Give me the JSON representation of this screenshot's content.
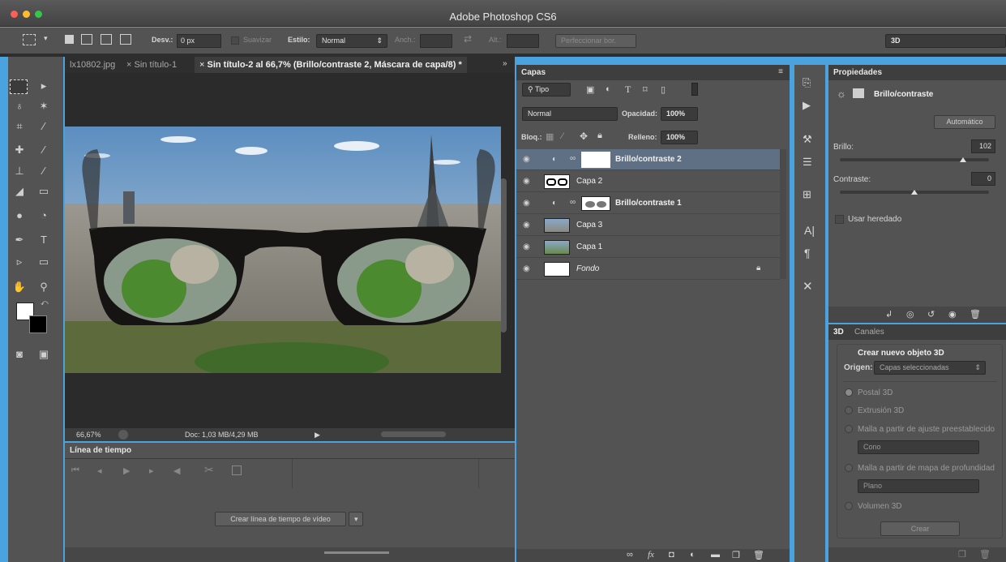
{
  "app": {
    "title": "Adobe Photoshop CS6"
  },
  "options": {
    "desv_label": "Desv.:",
    "desv_value": "0 px",
    "suavizar": "Suavizar",
    "estilo_label": "Estilo:",
    "estilo_value": "Normal",
    "anch_label": "Anch.:",
    "alt_label": "Alt.:",
    "refine_button": "Perfeccionar bor.",
    "workspace": "3D"
  },
  "tabs": [
    {
      "label": "lx10802.jpg"
    },
    {
      "label": "Sin título-1"
    },
    {
      "label": "Sin título-2 al 66,7% (Brillo/contraste 2, Máscara de capa/8) *"
    }
  ],
  "status": {
    "zoom": "66,67%",
    "doc": "Doc: 1,03 MB/4,29 MB"
  },
  "timeline": {
    "title": "Línea de tiempo",
    "create_button": "Crear línea de tiempo de vídeo"
  },
  "layers": {
    "title": "Capas",
    "filter": "Tipo",
    "blend": "Normal",
    "opacity_label": "Opacidad:",
    "opacity_value": "100%",
    "lock_label": "Bloq.:",
    "fill_label": "Relleno:",
    "fill_value": "100%",
    "items": [
      {
        "name": "Brillo/contraste 2"
      },
      {
        "name": "Capa 2"
      },
      {
        "name": "Brillo/contraste 1"
      },
      {
        "name": "Capa 3"
      },
      {
        "name": "Capa 1"
      },
      {
        "name": "Fondo"
      }
    ]
  },
  "properties": {
    "title": "Propiedades",
    "type": "Brillo/contraste",
    "auto_button": "Automático",
    "brillo_label": "Brillo:",
    "brillo_value": "102",
    "brillo_level": 0.8,
    "contraste_label": "Contraste:",
    "contraste_value": "0",
    "contraste_level": 0.5,
    "legacy": "Usar heredado"
  },
  "panel3d": {
    "tab_3d": "3D",
    "tab_canales": "Canales",
    "heading": "Crear nuevo objeto 3D",
    "origin_label": "Origen:",
    "origin_value": "Capas seleccionadas",
    "options": [
      "Postal 3D",
      "Extrusión 3D",
      "Malla a partir de ajuste preestablecido",
      "Malla a partir de mapa de profundidad",
      "Volumen 3D"
    ],
    "preset_value": "Cono",
    "depth_value": "Plano",
    "create_button": "Crear"
  },
  "colors": {
    "selected_layer": "#5f6f84",
    "accent": "#4aa3df"
  }
}
